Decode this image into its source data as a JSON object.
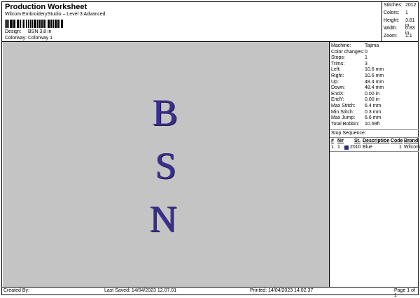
{
  "header": {
    "title": "Production Worksheet",
    "subtitle": "Wilcom EmbroideryStudio – Level 3 Advanced",
    "design_label": "Design:",
    "design_value": "BSN 3,8 in",
    "colorway_label": "Colorway:",
    "colorway_value": "Colorway 1"
  },
  "stats": [
    {
      "label": "Stitches:",
      "value": "2012"
    },
    {
      "label": "Colors:",
      "value": "1"
    },
    {
      "label": "Height:",
      "value": "3.81 in"
    },
    {
      "label": "Width:",
      "value": "0.83 in"
    },
    {
      "label": "Zoom:",
      "value": "1:1"
    }
  ],
  "design": {
    "letters": [
      "B",
      "S",
      "N"
    ],
    "thread_color": "#3a2f86",
    "background_color": "#c4c4c4"
  },
  "machine_info": [
    {
      "label": "Machine:",
      "value": "Tajima"
    },
    {
      "label": "Color changes:",
      "value": "0"
    },
    {
      "label": "Stops:",
      "value": "1"
    },
    {
      "label": "Trims:",
      "value": "3"
    },
    {
      "label": "Left:",
      "value": "10.6 mm"
    },
    {
      "label": "Right:",
      "value": "10.6 mm"
    },
    {
      "label": "Up:",
      "value": "48.4 mm"
    },
    {
      "label": "Down:",
      "value": "48.4 mm"
    },
    {
      "label": "EndX:",
      "value": "0.00 in"
    },
    {
      "label": "EndY:",
      "value": "0.00 in"
    },
    {
      "label": "Max Stitch:",
      "value": "6.4 mm"
    },
    {
      "label": "Min Stitch:",
      "value": "0.3 mm"
    },
    {
      "label": "Max Jump:",
      "value": "6.6 mm"
    },
    {
      "label": "Total Bobbin:",
      "value": "10.69ft"
    }
  ],
  "stop_sequence": {
    "title": "Stop Sequence:",
    "columns": [
      "#",
      "N#",
      "St.",
      "Description",
      "Code",
      "Brand"
    ],
    "rows": [
      {
        "idx": "1.",
        "n": "1",
        "color": "#2a2a7a",
        "st": "2010",
        "description": "Blue",
        "code": "1",
        "brand": "Wilcom"
      }
    ]
  },
  "footer": {
    "created_by": "Created By:",
    "last_saved": "Last Saved: 14/04/2023 12.07.01",
    "printed": "Printed: 14/04/2023 14.02.37",
    "page": "Page 1 of 1"
  }
}
